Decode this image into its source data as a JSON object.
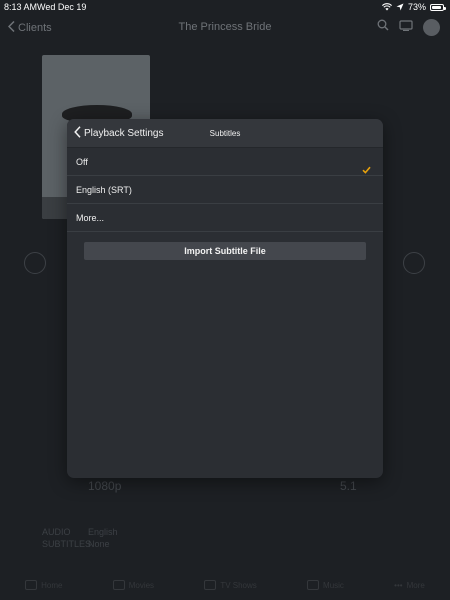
{
  "status_bar": {
    "time": "8:13 AM",
    "date": "Wed Dec 19",
    "battery": "73%",
    "battery_level": 0.73,
    "icons": [
      "wifi-icon",
      "location-icon",
      "battery-icon"
    ]
  },
  "background": {
    "nav": {
      "back_label": "Clients",
      "title": "The Princess Bride",
      "icons": [
        "search-icon",
        "cast-icon",
        "avatar"
      ]
    },
    "resolution": "1080p",
    "audio_channels": "5.1",
    "audio_label": "AUDIO",
    "audio_value": "English",
    "subtitles_label": "SUBTITLES",
    "subtitles_value": "None",
    "tabs": [
      "Home",
      "Movies",
      "TV Shows",
      "Music",
      "More"
    ]
  },
  "modal": {
    "back_label": "Playback Settings",
    "title": "Subtitles",
    "options": [
      {
        "label": "Off",
        "selected": true
      },
      {
        "label": "English (SRT)",
        "selected": false
      },
      {
        "label": "More...",
        "selected": false
      }
    ],
    "import_button": "Import Subtitle File",
    "accent_color": "#e5a00d"
  }
}
